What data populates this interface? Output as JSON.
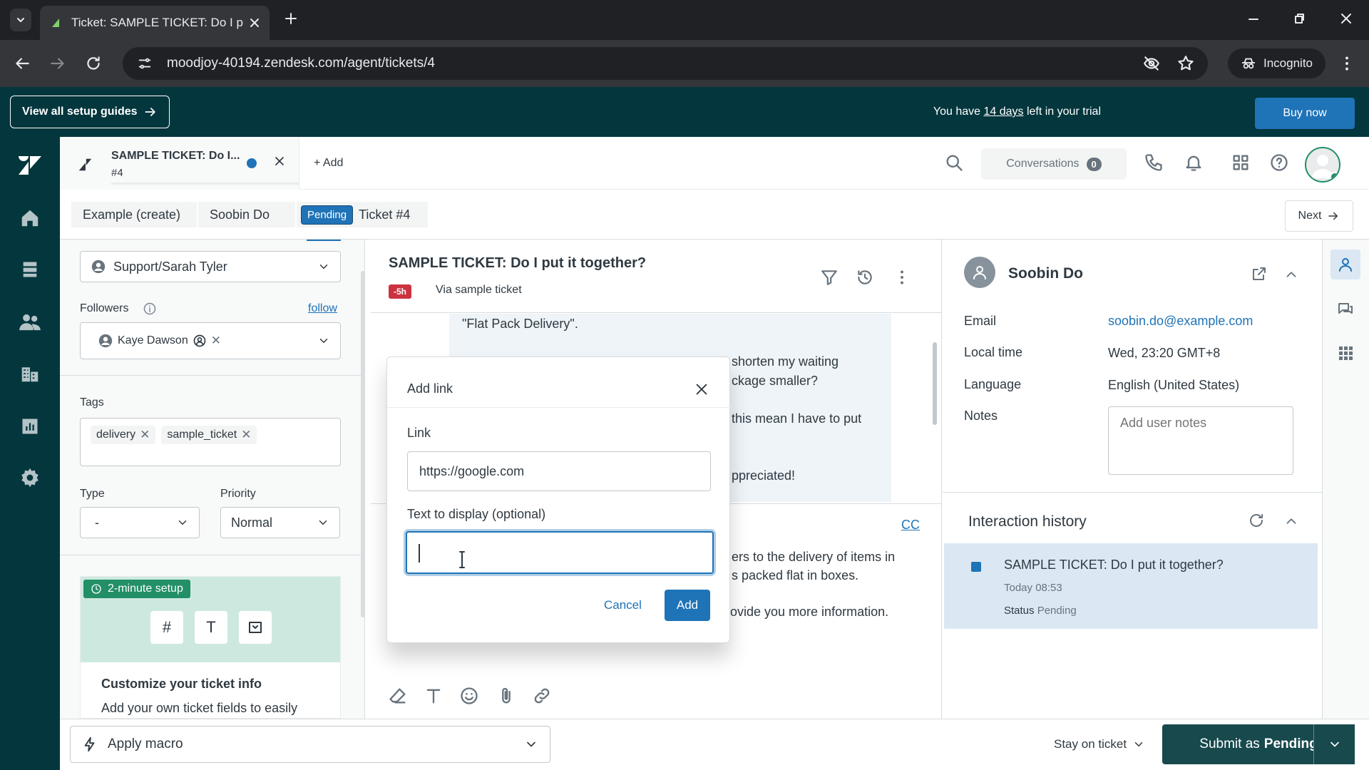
{
  "browser": {
    "tab_title": "Ticket: SAMPLE TICKET: Do I put it together?",
    "url": "moodjoy-40194.zendesk.com/agent/tickets/4",
    "incognito_label": "Incognito"
  },
  "banner": {
    "guides_label": "View all setup guides",
    "trial_prefix": "You have ",
    "trial_days": "14 days",
    "trial_suffix": " left in your trial",
    "buy_label": "Buy now"
  },
  "header": {
    "ticket_tab_title": "SAMPLE TICKET: Do I...",
    "ticket_tab_number": "#4",
    "add_label": "+ Add",
    "conversations_label": "Conversations",
    "conversations_count": "0"
  },
  "breadcrumb": {
    "item1": "Example (create)",
    "item2": "Soobin Do",
    "status": "Pending",
    "ticket": "Ticket #4",
    "next_label": "Next"
  },
  "properties": {
    "assignee": "Support/Sarah Tyler",
    "followers_label": "Followers",
    "follow_link": "follow",
    "follower_name": "Kaye Dawson",
    "tags_label": "Tags",
    "tags": [
      "delivery",
      "sample_ticket"
    ],
    "type_label": "Type",
    "type_value": "-",
    "priority_label": "Priority",
    "priority_value": "Normal",
    "setup_tag": "2-minute setup",
    "setup_title": "Customize your ticket info",
    "setup_text": "Add your own ticket fields to easily"
  },
  "conversation": {
    "title": "SAMPLE TICKET: Do I put it together?",
    "age_badge": "-5h",
    "via": "Via sample ticket",
    "lines": [
      "\"Flat Pack Delivery\".",
      "shorten my waiting",
      "ckage smaller?",
      "this mean I have to put",
      "ppreciated!"
    ],
    "cc_label": "CC",
    "reply_lines": [
      "ers to the delivery of items in",
      "s packed flat in boxes.",
      "rovide you more information."
    ]
  },
  "modal": {
    "title": "Add link",
    "link_label": "Link",
    "link_value": "https://google.com",
    "display_label": "Text to display (optional)",
    "display_value": "",
    "cancel_label": "Cancel",
    "add_label": "Add"
  },
  "user": {
    "name": "Soobin Do",
    "email_label": "Email",
    "email": "soobin.do@example.com",
    "localtime_label": "Local time",
    "localtime": "Wed, 23:20 GMT+8",
    "language_label": "Language",
    "language": "English (United States)",
    "notes_label": "Notes",
    "notes_placeholder": "Add user notes",
    "history_title": "Interaction history",
    "history_item_title": "SAMPLE TICKET: Do I put it together?",
    "history_item_time": "Today 08:53",
    "history_item_status_label": "Status",
    "history_item_status": "Pending"
  },
  "footer": {
    "macro_label": "Apply macro",
    "stay_label": "Stay on ticket",
    "submit_prefix": "Submit as",
    "submit_status": "Pending"
  },
  "colors": {
    "brand_dark": "#03363d",
    "primary_blue": "#1f73b7",
    "submit_bg": "#17494d",
    "sla_red": "#cc3340",
    "setup_green": "#228f67"
  }
}
